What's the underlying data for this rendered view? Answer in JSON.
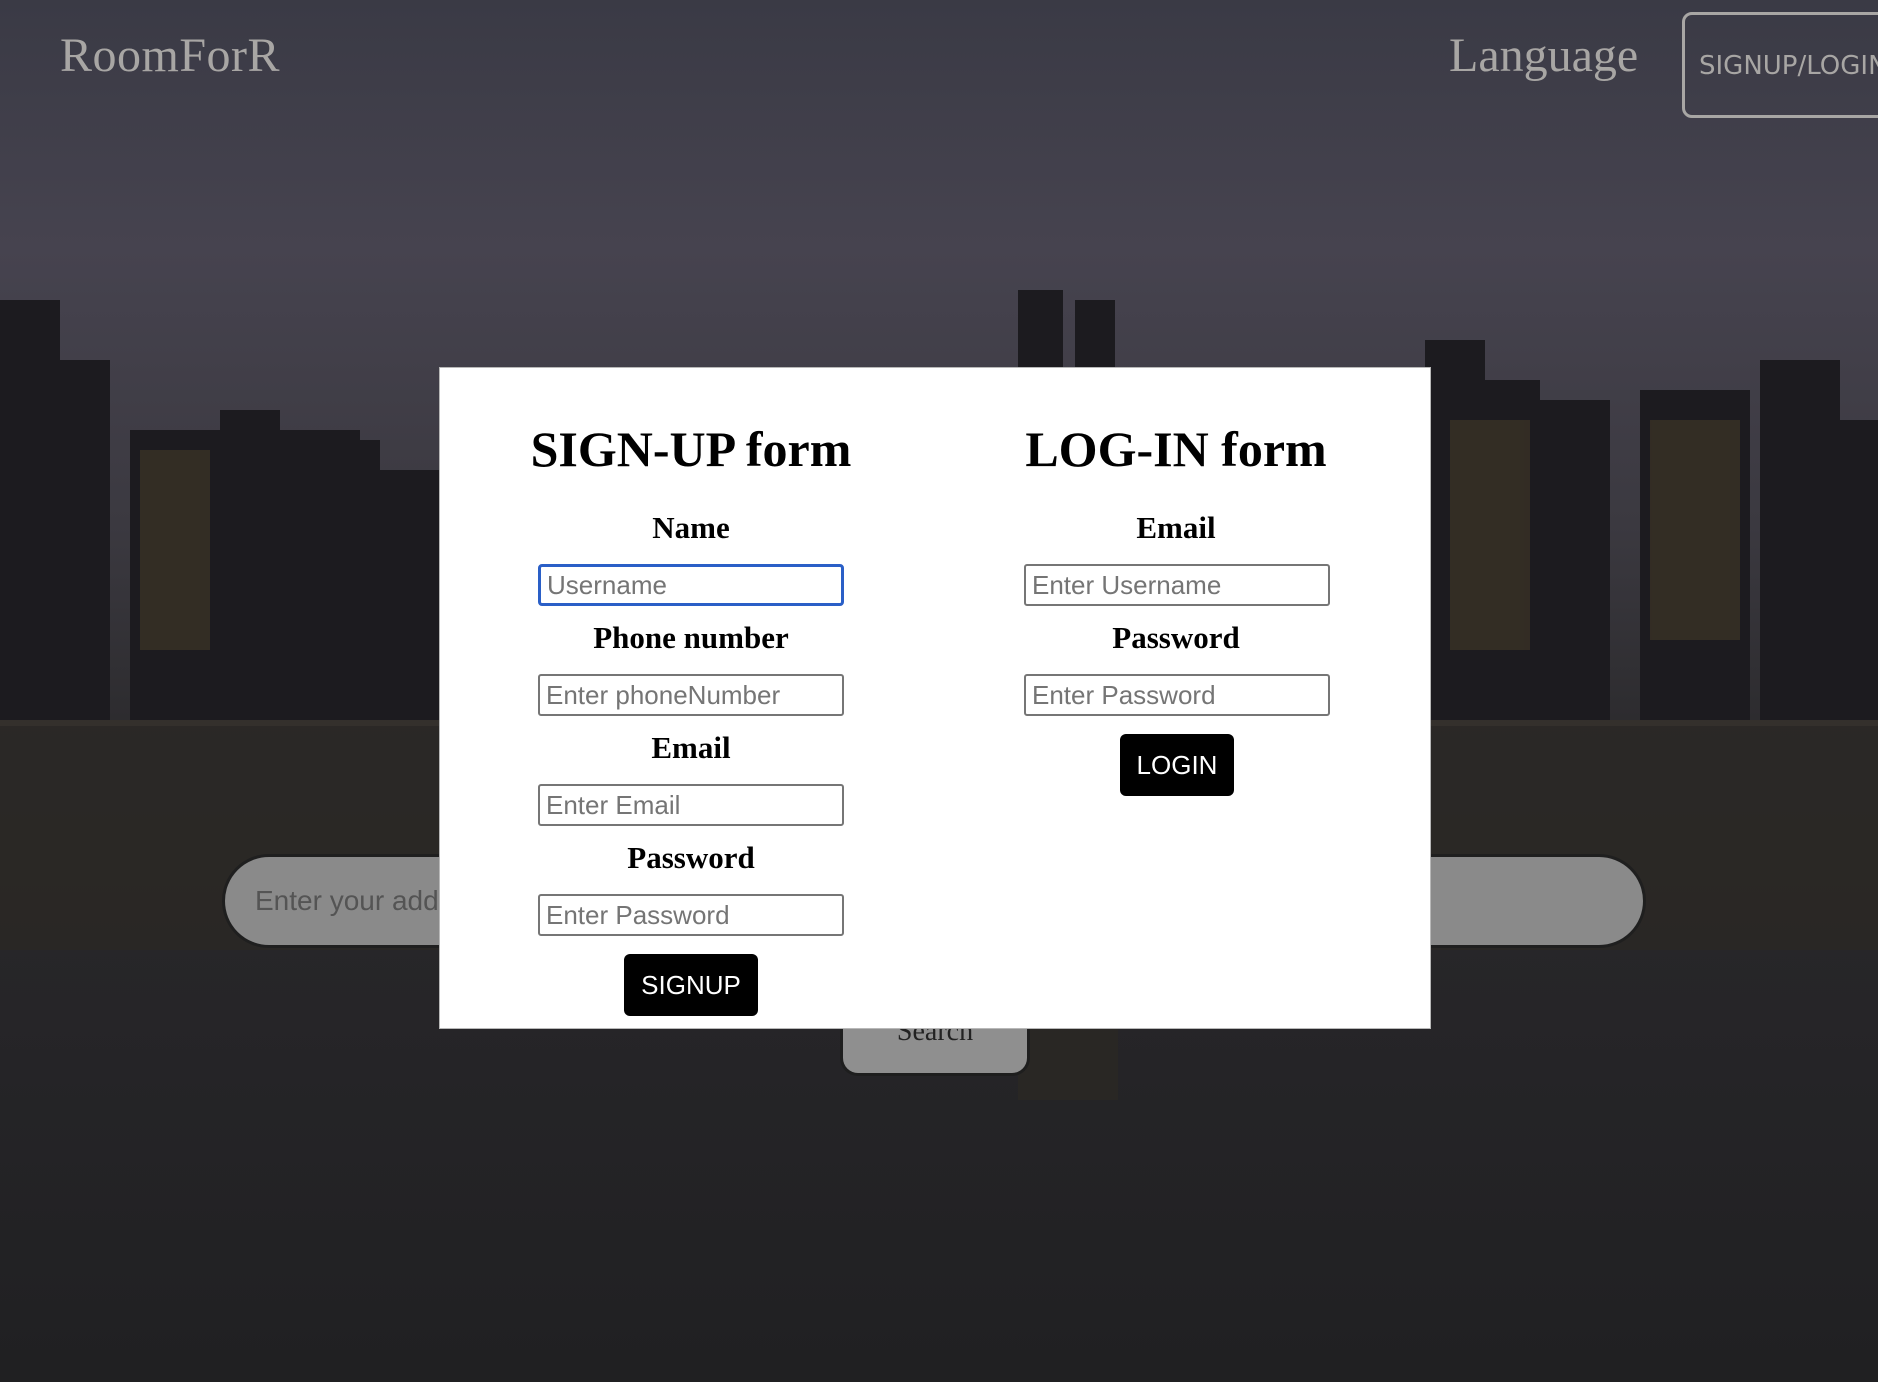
{
  "header": {
    "logo": "RoomForR",
    "language_label": "Language",
    "signup_login_label": "SIGNUP/LOGIN"
  },
  "search": {
    "placeholder": "Enter your address",
    "button_label": "Search"
  },
  "signup_form": {
    "title": "SIGN-UP form",
    "name_label": "Name",
    "name_placeholder": "Username",
    "phone_label": "Phone number",
    "phone_placeholder": "Enter phoneNumber",
    "email_label": "Email",
    "email_placeholder": "Enter Email",
    "password_label": "Password",
    "password_placeholder": "Enter Password",
    "submit_label": "SIGNUP"
  },
  "login_form": {
    "title": "LOG-IN form",
    "email_label": "Email",
    "email_placeholder": "Enter Username",
    "password_label": "Password",
    "password_placeholder": "Enter Password",
    "submit_label": "LOGIN"
  },
  "colors": {
    "modal_background": "#ffffff",
    "button_background": "#000000",
    "focus_border": "#2a5fc7",
    "header_text": "#a8a6a4"
  }
}
